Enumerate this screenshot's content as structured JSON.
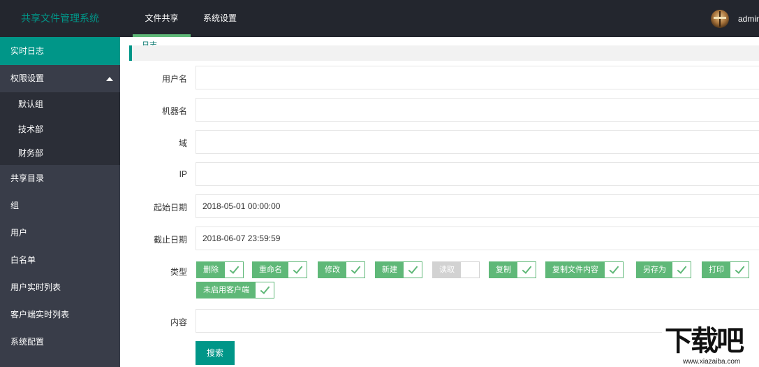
{
  "header": {
    "brand": "共享文件管理系统",
    "nav": [
      {
        "label": "文件共享",
        "active": true
      },
      {
        "label": "系统设置",
        "active": false
      }
    ],
    "user": {
      "name": "admin",
      "avatar_icon": "user-avatar"
    }
  },
  "sidebar": {
    "items": [
      {
        "label": "实时日志",
        "active": true
      },
      {
        "label": "权限设置",
        "expanded": true,
        "children": [
          "默认组",
          "技术部",
          "财务部"
        ]
      },
      {
        "label": "共享目录"
      },
      {
        "label": "组"
      },
      {
        "label": "用户"
      },
      {
        "label": "白名单"
      },
      {
        "label": "用户实时列表"
      },
      {
        "label": "客户端实时列表"
      },
      {
        "label": "系统配置"
      }
    ]
  },
  "breadcrumb": {
    "text": "日志"
  },
  "form": {
    "username": {
      "label": "用户名",
      "value": ""
    },
    "machine": {
      "label": "机器名",
      "value": ""
    },
    "domain": {
      "label": "域",
      "value": ""
    },
    "ip": {
      "label": "IP",
      "value": ""
    },
    "start_date": {
      "label": "起始日期",
      "value": "2018-05-01 00:00:00"
    },
    "end_date": {
      "label": "截止日期",
      "value": "2018-06-07 23:59:59"
    },
    "type_label": "类型",
    "types": [
      {
        "label": "删除",
        "checked": true
      },
      {
        "label": "重命名",
        "checked": true
      },
      {
        "label": "修改",
        "checked": true
      },
      {
        "label": "新建",
        "checked": true
      },
      {
        "label": "读取",
        "checked": false
      },
      {
        "label": "复制",
        "checked": true
      },
      {
        "label": "复制文件内容",
        "checked": true
      },
      {
        "label": "另存为",
        "checked": true
      },
      {
        "label": "打印",
        "checked": true
      },
      {
        "label": "未启用客户端",
        "checked": true
      }
    ],
    "content": {
      "label": "内容",
      "value": ""
    },
    "search_label": "搜索"
  },
  "watermark": {
    "main": "下载吧",
    "url": "www.xiazaiba.com"
  },
  "colors": {
    "header_bg": "#23262e",
    "sidebar_bg": "#393d49",
    "submenu_bg": "#2b2e37",
    "accent": "#009688",
    "check_green": "#5fb878"
  }
}
